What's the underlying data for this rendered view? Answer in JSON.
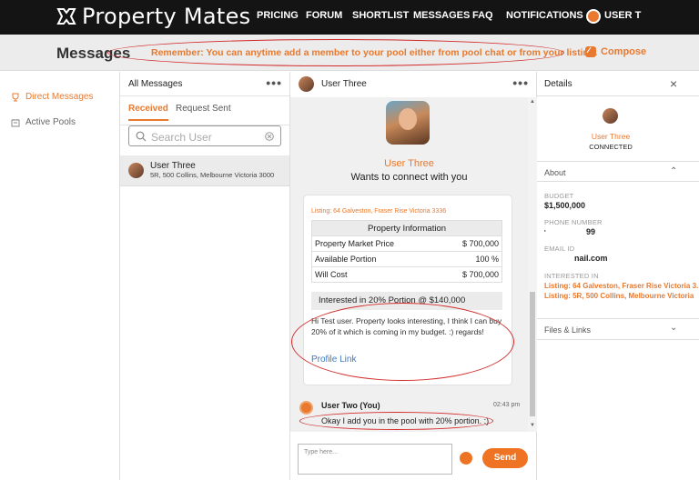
{
  "nav": {
    "brand": "Property Mates",
    "items": [
      "PRICING",
      "FORUM",
      "SHORTLIST",
      "MESSAGES",
      "FAQ",
      "NOTIFICATIONS"
    ],
    "user": "USER T"
  },
  "subbar": {
    "title": "Messages",
    "notice": "Remember: You can anytime add a member to your pool either from pool chat or from your listing.",
    "compose": "Compose"
  },
  "sidebar": {
    "items": [
      {
        "label": "Direct Messages",
        "icon": "trophy-icon",
        "active": true
      },
      {
        "label": "Active Pools",
        "icon": "pool-icon",
        "active": false
      }
    ]
  },
  "inbox": {
    "header": "All Messages",
    "tabs": [
      "Received",
      "Request Sent"
    ],
    "search_placeholder": "Search User",
    "items": [
      {
        "name": "User Three",
        "address": "5R, 500 Collins, Melbourne Victoria 3000"
      }
    ]
  },
  "chat": {
    "header": "User Three",
    "requester_name": "User Three",
    "request_text": "Wants to connect with you",
    "listing": "Listing: 64 Galveston, Fraser Rise Victoria 3336",
    "table_title": "Property Information",
    "rows": [
      {
        "label": "Property Market Price",
        "value": "$ 700,000"
      },
      {
        "label": "Available Portion",
        "value": "100 %"
      },
      {
        "label": "Will Cost",
        "value": "$ 700,000"
      }
    ],
    "interest": "Interested in 20% Portion @ $140,000",
    "message": "Hi Test user. Property looks interesting, I think I can buy 20% of it which is coming in my budget. :) regards!",
    "profile_link": "Profile Link",
    "reply_author": "User Two (You)",
    "reply_time": "02:43 pm",
    "reply_text": "Okay I add you in the pool with 20% portion. :)",
    "composer_placeholder": "Type here...",
    "send": "Send"
  },
  "details": {
    "title": "Details",
    "name": "User Three",
    "status": "CONNECTED",
    "about": "About",
    "budget_label": "BUDGET",
    "budget": "$1,500,000",
    "phone_label": "PHONE NUMBER",
    "phone_prefix": "'",
    "phone": "99",
    "email_label": "EMAIL ID",
    "email": "nail.com",
    "interested_label": "INTERESTED IN",
    "interested": [
      "Listing: 64 Galveston, Fraser Rise Victoria 3.",
      "Listing: 5R, 500 Collins, Melbourne Victoria"
    ],
    "files": "Files & Links"
  },
  "colors": {
    "accent": "#e8792e",
    "annotation": "#d32b2b",
    "topbar": "#141414"
  }
}
